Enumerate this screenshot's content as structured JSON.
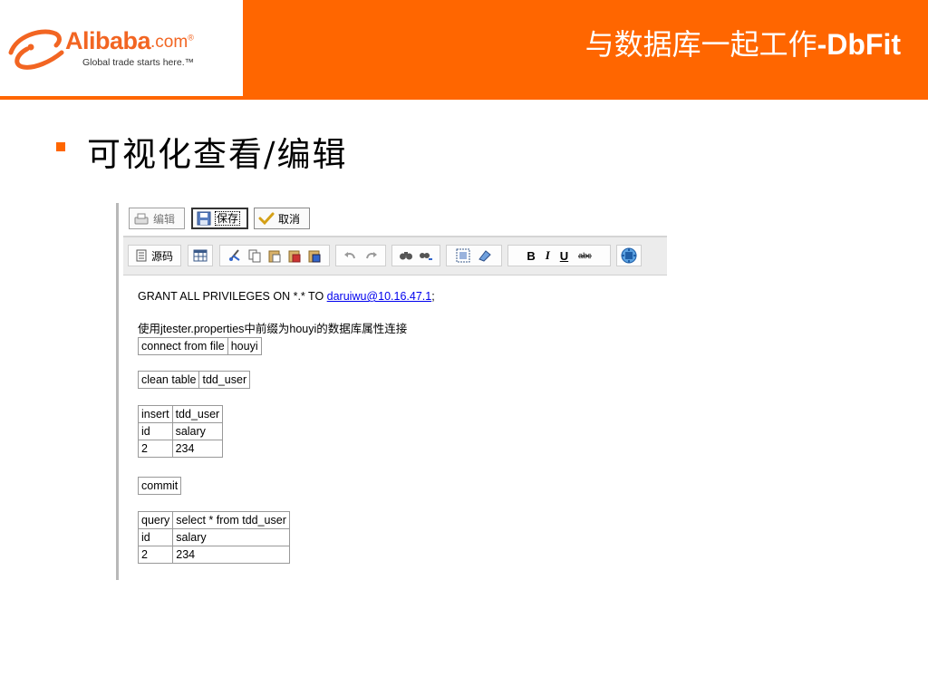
{
  "header": {
    "brand": "Alibaba",
    "brand_suffix": ".com",
    "registered": "®",
    "tagline": "Global trade starts here.™",
    "title_cn": "与数据库一起工作",
    "title_en": "-DbFit"
  },
  "bullet": {
    "text": "可视化查看/编辑"
  },
  "editor": {
    "buttons": {
      "edit": "编辑",
      "save": "保存",
      "cancel": "取消"
    },
    "toolbar": {
      "source": "源码",
      "bold": "B",
      "italic": "I",
      "underline": "U",
      "strike": "abc",
      "icons": [
        "source-icon",
        "table-icon",
        "cut-icon",
        "copy-icon",
        "paste-icon",
        "paste-text-icon",
        "paste-word-icon",
        "undo-icon",
        "redo-icon",
        "find-icon",
        "replace-icon",
        "select-all-icon",
        "remove-format-icon",
        "bold-icon",
        "italic-icon",
        "underline-icon",
        "strike-icon",
        "maximize-icon"
      ]
    },
    "content": {
      "grant_prefix": "GRANT ALL PRIVILEGES ON *.* TO ",
      "grant_link": "daruiwu@10.16.47.1",
      "grant_suffix": ";",
      "description": "使用jtester.properties中前缀为houyi的数据库属性连接",
      "connect": [
        "connect from file",
        "houyi"
      ],
      "clean": [
        "clean table",
        "tdd_user"
      ],
      "insert": {
        "header": [
          "insert",
          "tdd_user"
        ],
        "columns": [
          "id",
          "salary"
        ],
        "row": [
          "2",
          "234"
        ]
      },
      "commit": "commit",
      "query": {
        "header": [
          "query",
          "select * from tdd_user"
        ],
        "columns": [
          "id",
          "salary"
        ],
        "row": [
          "2",
          "234"
        ]
      }
    }
  },
  "colors": {
    "accent": "#ff6600",
    "link": "#0000ee"
  }
}
